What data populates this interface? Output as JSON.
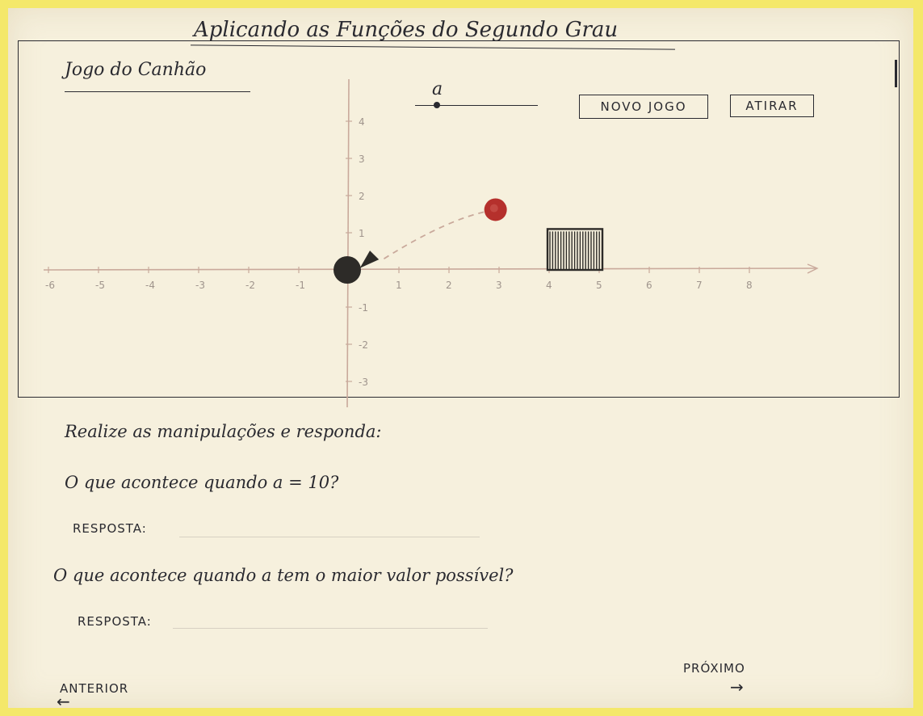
{
  "page": {
    "title": "Aplicando as Funções do Segundo Grau"
  },
  "game": {
    "title": "Jogo do Canhão",
    "slider_label": "a",
    "new_game_label": "NOVO JOGO",
    "fire_label": "ATIRAR",
    "x_tick_labels": [
      "-6",
      "-5",
      "-4",
      "-3",
      "-2",
      "-1",
      "1",
      "2",
      "3",
      "4",
      "5",
      "6",
      "7",
      "8"
    ],
    "y_tick_labels": [
      "4",
      "3",
      "2",
      "1",
      "-1",
      "-2",
      "-3"
    ],
    "colors": {
      "pencil": "#2a2a30",
      "axis": "#c9a99b",
      "ball": "#b5302c",
      "cannon": "#2d2b28",
      "paper": "#f6f0dd",
      "border": "#f4e86a"
    }
  },
  "questions": {
    "instruction": "Realize as manipulações e responda:",
    "q1": "O que acontece quando a = 10?",
    "q1_answer_label": "RESPOSTA:",
    "q1_answer_value": "",
    "q2": "O que acontece quando a tem o maior valor possível?",
    "q2_answer_label": "RESPOSTA:",
    "q2_answer_value": ""
  },
  "nav": {
    "prev_label": "ANTERIOR",
    "prev_icon": "arrow-left-icon",
    "next_label": "PRÓXIMO",
    "next_icon": "arrow-right-icon"
  }
}
